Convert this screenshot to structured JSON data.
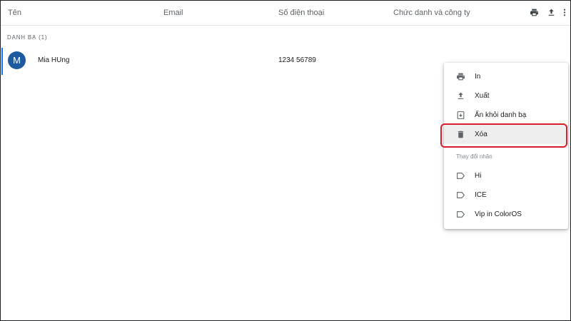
{
  "header": {
    "columns": {
      "name": "Tên",
      "email": "Email",
      "phone": "Số điện thoại",
      "title_company": "Chức danh và công ty"
    },
    "icons": [
      "print-icon",
      "export-icon",
      "more-vert-icon"
    ]
  },
  "section": {
    "label": "DANH BẠ (1)"
  },
  "contacts": [
    {
      "initial": "M",
      "name": "Mia HUng",
      "email": "",
      "phone": "1234 56789",
      "avatar_color": "#1f5aa0"
    }
  ],
  "menu": {
    "items": [
      {
        "label": "In",
        "icon": "print-icon"
      },
      {
        "label": "Xuất",
        "icon": "export-icon"
      },
      {
        "label": "Ẩn khỏi danh bạ",
        "icon": "hide-contact-icon"
      },
      {
        "label": "Xóa",
        "icon": "trash-icon",
        "highlighted": true
      }
    ],
    "labels_heading": "Thay đổi nhãn",
    "labels": [
      {
        "label": "Hi",
        "icon": "label-icon"
      },
      {
        "label": "ICE",
        "icon": "label-icon"
      },
      {
        "label": "Vip in ColorOS",
        "icon": "label-icon"
      }
    ]
  },
  "colors": {
    "accent": "#1a73e8",
    "avatar": "#1f5aa0",
    "highlight_outline": "#d3202f",
    "icon_gray": "#5f6368"
  }
}
